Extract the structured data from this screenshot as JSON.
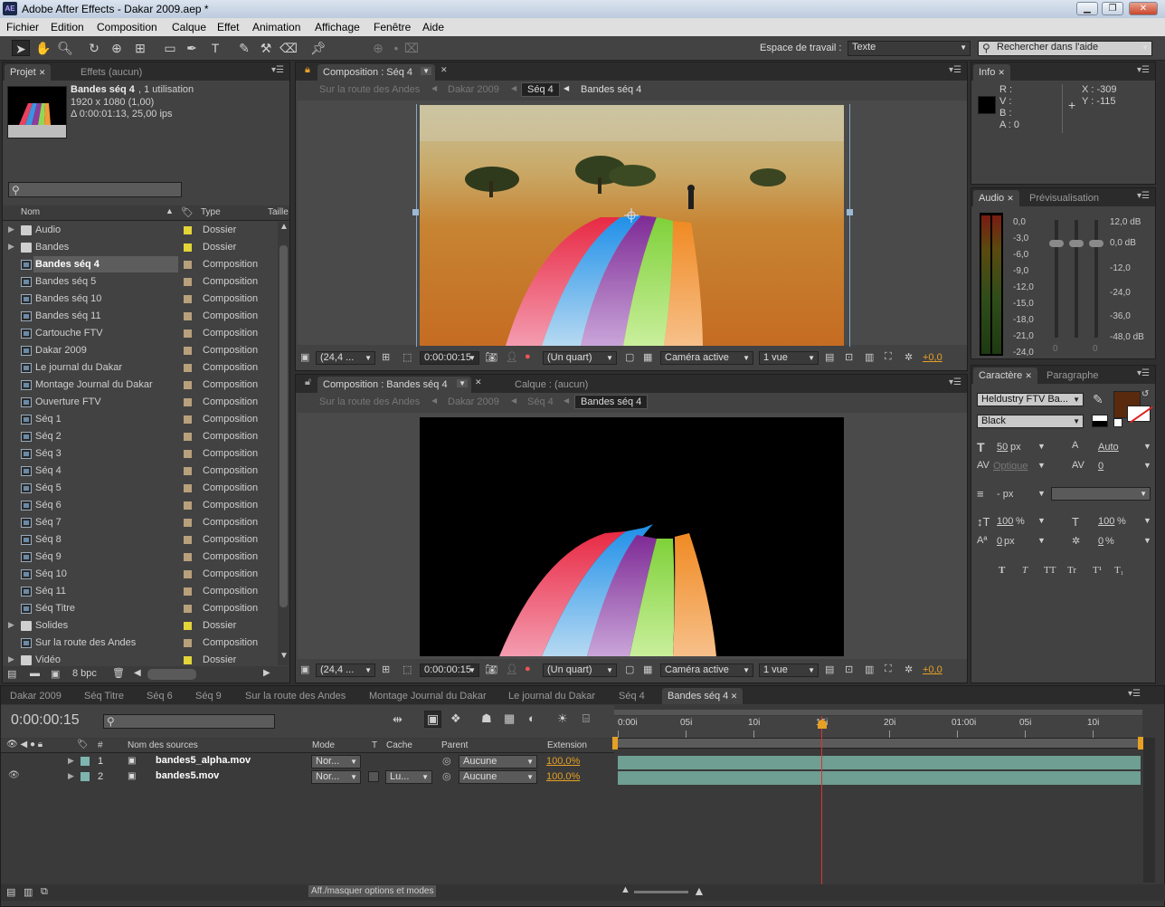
{
  "window": {
    "title": "Adobe After Effects - Dakar 2009.aep *",
    "app_icon_text": "AE"
  },
  "menu": [
    "Fichier",
    "Edition",
    "Composition",
    "Calque",
    "Effet",
    "Animation",
    "Affichage",
    "Fenêtre",
    "Aide"
  ],
  "toolbar": {
    "workspace_label": "Espace de travail :",
    "workspace_value": "Texte",
    "help_search_placeholder": "Rechercher dans l'aide"
  },
  "project_panel": {
    "tabs": [
      "Projet",
      "Effets (aucun)"
    ],
    "preview": {
      "name": "Bandes séq 4",
      "usage": ", 1 utilisation",
      "dims": "1920 x 1080 (1,00)",
      "duration": "Δ 0:00:01:13, 25,00 ips"
    },
    "columns": {
      "name": "Nom",
      "type": "Type",
      "size": "Taille"
    },
    "items": [
      {
        "name": "Audio",
        "type": "Dossier",
        "kind": "folder",
        "swatch": "#e3d43a"
      },
      {
        "name": "Bandes",
        "type": "Dossier",
        "kind": "folder",
        "swatch": "#e3d43a"
      },
      {
        "name": "Bandes séq 4",
        "type": "Composition",
        "kind": "comp",
        "swatch": "#b8a07c",
        "selected": true
      },
      {
        "name": "Bandes séq 5",
        "type": "Composition",
        "kind": "comp",
        "swatch": "#b8a07c"
      },
      {
        "name": "Bandes séq 10",
        "type": "Composition",
        "kind": "comp",
        "swatch": "#b8a07c"
      },
      {
        "name": "Bandes séq 11",
        "type": "Composition",
        "kind": "comp",
        "swatch": "#b8a07c"
      },
      {
        "name": "Cartouche FTV",
        "type": "Composition",
        "kind": "comp",
        "swatch": "#b8a07c"
      },
      {
        "name": "Dakar 2009",
        "type": "Composition",
        "kind": "comp",
        "swatch": "#b8a07c"
      },
      {
        "name": "Le journal du Dakar",
        "type": "Composition",
        "kind": "comp",
        "swatch": "#b8a07c"
      },
      {
        "name": "Montage Journal du Dakar",
        "type": "Composition",
        "kind": "comp",
        "swatch": "#b8a07c"
      },
      {
        "name": "Ouverture FTV",
        "type": "Composition",
        "kind": "comp",
        "swatch": "#b8a07c"
      },
      {
        "name": "Séq 1",
        "type": "Composition",
        "kind": "comp",
        "swatch": "#b8a07c"
      },
      {
        "name": "Séq 2",
        "type": "Composition",
        "kind": "comp",
        "swatch": "#b8a07c"
      },
      {
        "name": "Séq 3",
        "type": "Composition",
        "kind": "comp",
        "swatch": "#b8a07c"
      },
      {
        "name": "Séq 4",
        "type": "Composition",
        "kind": "comp",
        "swatch": "#b8a07c"
      },
      {
        "name": "Séq 5",
        "type": "Composition",
        "kind": "comp",
        "swatch": "#b8a07c"
      },
      {
        "name": "Séq 6",
        "type": "Composition",
        "kind": "comp",
        "swatch": "#b8a07c"
      },
      {
        "name": "Séq 7",
        "type": "Composition",
        "kind": "comp",
        "swatch": "#b8a07c"
      },
      {
        "name": "Séq 8",
        "type": "Composition",
        "kind": "comp",
        "swatch": "#b8a07c"
      },
      {
        "name": "Séq 9",
        "type": "Composition",
        "kind": "comp",
        "swatch": "#b8a07c"
      },
      {
        "name": "Séq 10",
        "type": "Composition",
        "kind": "comp",
        "swatch": "#b8a07c"
      },
      {
        "name": "Séq 11",
        "type": "Composition",
        "kind": "comp",
        "swatch": "#b8a07c"
      },
      {
        "name": "Séq Titre",
        "type": "Composition",
        "kind": "comp",
        "swatch": "#b8a07c"
      },
      {
        "name": "Solides",
        "type": "Dossier",
        "kind": "folder",
        "swatch": "#e3d43a"
      },
      {
        "name": "Sur la route des Andes",
        "type": "Composition",
        "kind": "comp",
        "swatch": "#b8a07c"
      },
      {
        "name": "Vidéo",
        "type": "Dossier",
        "kind": "folder",
        "swatch": "#e3d43a"
      }
    ],
    "bpc": "8 bpc"
  },
  "viewer_top": {
    "tab": "Composition : Séq 4",
    "crumbs": [
      "Sur la route des Andes",
      "Dakar 2009",
      "Séq 4",
      "Bandes séq 4"
    ],
    "zoom": "(24,4 ...",
    "time": "0:00:00:15",
    "resolution": "(Un quart)",
    "camera": "Caméra active",
    "views": "1 vue",
    "exposure": "+0,0"
  },
  "viewer_bottom": {
    "tab": "Composition : Bandes séq 4",
    "layer_tab": "Calque : (aucun)",
    "crumbs": [
      "Sur la route des Andes",
      "Dakar 2009",
      "Séq 4",
      "Bandes séq 4"
    ],
    "zoom": "(24,4 ...",
    "time": "0:00:00:15",
    "resolution": "(Un quart)",
    "camera": "Caméra active",
    "views": "1 vue",
    "exposure": "+0,0"
  },
  "info_panel": {
    "tab": "Info",
    "r": "R :",
    "v": "V :",
    "b": "B :",
    "a": "A : 0",
    "x": "X : -309",
    "y": "Y : -115"
  },
  "audio_panel": {
    "tabs": [
      "Audio",
      "Prévisualisation"
    ],
    "left_scale": [
      "0,0",
      "-3,0",
      "-6,0",
      "-9,0",
      "-12,0",
      "-15,0",
      "-18,0",
      "-21,0",
      "-24,0"
    ],
    "right_scale": [
      "12,0 dB",
      "0,0 dB",
      "-12,0",
      "-24,0",
      "-36,0",
      "-48,0 dB"
    ],
    "slider_values": [
      "0",
      "0"
    ]
  },
  "char_panel": {
    "tabs": [
      "Caractère",
      "Paragraphe"
    ],
    "font": "Heldustry FTV Ba...",
    "style": "Black",
    "size": "50",
    "size_unit": "px",
    "leading": "Auto",
    "kerning": "Optique",
    "tracking": "0",
    "stroke_unit": "- px",
    "vscale": "100",
    "hscale": "100",
    "baseline": "0",
    "baseline_unit": "px",
    "tsume": "0",
    "pct": "%",
    "font_styles": [
      "T",
      "T",
      "TT",
      "Tr",
      "T¹",
      "T₁"
    ],
    "fill_color": "#5a2a0e"
  },
  "timeline": {
    "tabs": [
      "Dakar 2009",
      "Séq Titre",
      "Séq 6",
      "Séq 9",
      "Sur la route des Andes",
      "Montage Journal du Dakar",
      "Le journal du Dakar",
      "Séq 4",
      "Bandes séq 4"
    ],
    "timecode": "0:00:00:15",
    "columns": {
      "hash": "#",
      "source": "Nom des sources",
      "mode": "Mode",
      "t": "T",
      "matte": "Cache",
      "parent": "Parent",
      "stretch": "Extension"
    },
    "ruler": [
      "0:00i",
      "05i",
      "10i",
      "15i",
      "20i",
      "01:00i",
      "05i",
      "10i"
    ],
    "current_time_fraction": 0.3,
    "layers": [
      {
        "num": "1",
        "name": "bandes5_alpha.mov",
        "mode": "Nor...",
        "matte": "",
        "parent": "Aucune",
        "stretch": "100,0%"
      },
      {
        "num": "2",
        "name": "bandes5.mov",
        "mode": "Nor...",
        "matte": "Lu...",
        "parent": "Aucune",
        "stretch": "100,0%"
      }
    ],
    "footer_toggle": "Aff./masquer options et modes"
  }
}
